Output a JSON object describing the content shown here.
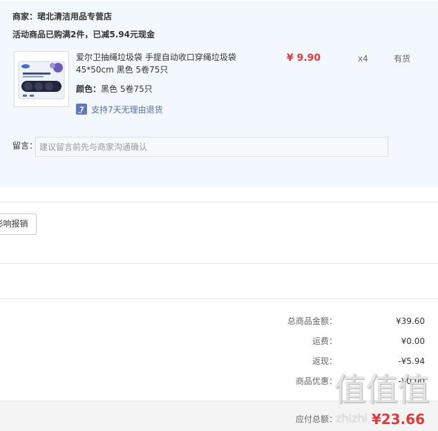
{
  "shop": {
    "label": "商家：",
    "name": "珺北清洁用品专营店"
  },
  "promotion": "活动商品已购满2件，已减5.94元现金",
  "product": {
    "title": "爱尔卫抽绳垃圾袋 手提自动收口穿绳垃圾袋 45*50cm 黑色 5卷75只",
    "price": "¥ 9.90",
    "quantity": "x4",
    "stock": "有货",
    "color_label": "颜色：",
    "color_value": "黑色 5卷75只",
    "return_icon_text": "7",
    "return_policy": "支持7天无理由退货",
    "image_icon": "trash-bag-package-image"
  },
  "message": {
    "label": "留言：",
    "placeholder": "建议留言前先与商家沟通确认"
  },
  "invoice_button": "影响报销",
  "summary": {
    "rows": [
      {
        "label": "总商品金额：",
        "value": "¥39.60"
      },
      {
        "label": "运费：",
        "value": "¥0.00"
      },
      {
        "label": "返现：",
        "value": "-¥5.94"
      },
      {
        "label": "商品优惠：",
        "value": "-¥0.00"
      }
    ],
    "total_label": "应付总额：",
    "total_value": "¥23.66"
  },
  "watermark": {
    "glyphs": "值值值",
    "text": "zhizhi"
  },
  "colors": {
    "panel_bg": "#f2f8fd",
    "price_red": "#e4393c",
    "link_blue": "#5270b1",
    "summary_bar_bg": "#f4f4f4"
  }
}
